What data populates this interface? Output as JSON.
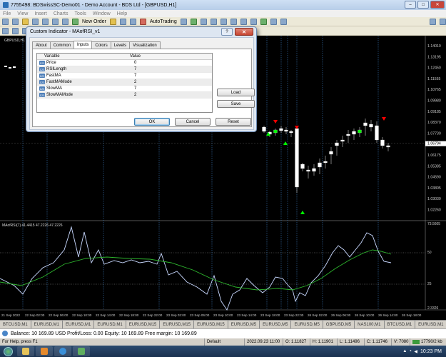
{
  "window": {
    "title": "7755498: BDSwissSC-Demo01 - Demo Account - BDS Ltd - [GBPUSD,H1]",
    "controls": [
      "–",
      "□",
      "✕"
    ]
  },
  "menu": [
    "File",
    "View",
    "Insert",
    "Charts",
    "Tools",
    "Window",
    "Help"
  ],
  "toolbar": {
    "new_order": "New Order",
    "autotrading": "AutoTrading"
  },
  "chart": {
    "symbol_label": "GBPUSD,H1",
    "price_labels": [
      "1.14010",
      "1.13195",
      "1.12450",
      "1.11555",
      "1.10765",
      "1.09980",
      "1.09185",
      "1.08370",
      "1.07730",
      "1.06794",
      "1.06175",
      "1.05385",
      "1.04590",
      "1.03805",
      "1.03030",
      "1.02260"
    ],
    "current_price": "1.06794",
    "indicator_label": "MAofRSI(7) 41.4415 47.2226 47.2226",
    "indicator_scale": [
      "73.5605",
      "50",
      "25",
      "2.3326"
    ],
    "time_labels": [
      "21 Sep 2022",
      "22 Sep 02:00",
      "22 Sep 06:00",
      "22 Sep 10:00",
      "22 Sep 14:00",
      "22 Sep 18:00",
      "22 Sep 22:00",
      "23 Sep 02:00",
      "23 Sep 06:00",
      "23 Sep 10:00",
      "23 Sep 14:00",
      "23 Sep 18:00",
      "23 Sep 22:00",
      "26 Sep 02:00",
      "26 Sep 06:00",
      "26 Sep 10:00",
      "26 Sep 14:00",
      "26 Sep 18:00"
    ]
  },
  "dialog": {
    "title": "Custom Indicator - MAofRSI_v1",
    "help": "?",
    "close": "✕",
    "tabs": [
      "About",
      "Common",
      "Inputs",
      "Colors",
      "Levels",
      "Visualization"
    ],
    "active_tab": "Inputs",
    "columns": [
      "Variable",
      "Value"
    ],
    "badge": "123",
    "params": [
      {
        "name": "Price",
        "value": "0"
      },
      {
        "name": "RSILength",
        "value": "7"
      },
      {
        "name": "FastMA",
        "value": "7"
      },
      {
        "name": "FastMAMode",
        "value": "2"
      },
      {
        "name": "SlowMA",
        "value": "7"
      },
      {
        "name": "SlowMAMode",
        "value": "2"
      }
    ],
    "load": "Load",
    "save": "Save",
    "ok": "OK",
    "cancel": "Cancel",
    "reset": "Reset"
  },
  "symbol_tabs": [
    "BTCUSD,M1",
    "EURUSD,M1",
    "EURUSD,M1",
    "EURUSD,M1",
    "EURUSD,M15",
    "EURUSD,M15",
    "EURUSD,M15",
    "EURUSD,M5",
    "EURUSD,M5",
    "EURUSD,M5",
    "GBPUSD,M5",
    "NAS100,M1",
    "BTCUSD,M1",
    "EURUSD,M1",
    "BTCUSD,M1",
    "GB"
  ],
  "active_symbol_tab": 15,
  "balance": "Balance: 10 169.89 USD  Profit/Loss: 0.00  Equity: 10 169.89  Free margin: 10 169.89",
  "status": {
    "help": "For Help, press F1",
    "profile": "Default",
    "datetime": "2022.09.23 11:00",
    "open": "O: 1.11827",
    "high": "H: 1.11901",
    "low": "L: 1.11496",
    "close": "C: 1.11746",
    "volume": "V: 7080",
    "traffic": "17790/2 kb"
  },
  "taskbar": {
    "time": "10:23 PM"
  },
  "colors": {
    "bull": "#ffffff",
    "bear": "#00ff00",
    "rsi": "#c8d8ff",
    "ma": "#2db52d",
    "up_arrow": "#00ff00",
    "down_arrow": "#ff0000"
  }
}
